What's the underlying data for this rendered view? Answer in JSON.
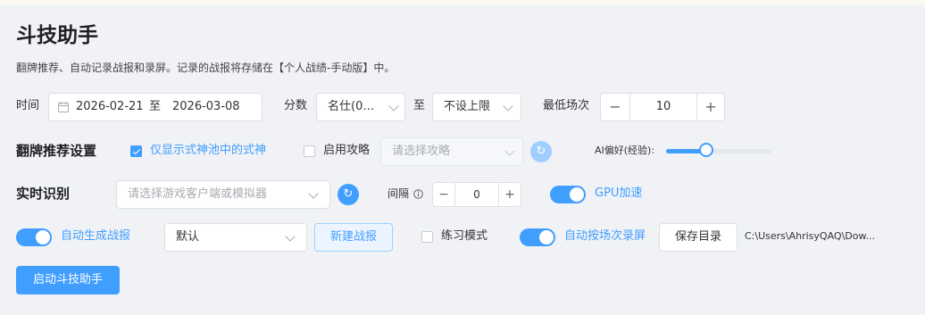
{
  "header": {
    "title": "斗技助手",
    "description": "翻牌推荐、自动记录战报和录屏。记录的战报将存储在【个人战绩-手动版】中。"
  },
  "filters": {
    "time_label": "时间",
    "date_start": "2026-02-21",
    "date_sep": "至",
    "date_end": "2026-03-08",
    "score_label": "分数",
    "score_from": "名仕(0…",
    "score_sep": "至",
    "score_to": "不设上限",
    "min_games_label": "最低场次",
    "min_games_value": "10",
    "minus": "−",
    "plus": "+"
  },
  "flip": {
    "section_title": "翻牌推荐设置",
    "only_pool_label": "仅显示式神池中的式神",
    "only_pool_checked": true,
    "strategy_label": "启用攻略",
    "strategy_checked": false,
    "strategy_placeholder": "请选择攻略",
    "ai_label": "AI偏好(经验):",
    "ai_value": 0.4
  },
  "realtime": {
    "section_title": "实时识别",
    "client_placeholder": "请选择游戏客户端或模拟器",
    "interval_label": "间隔",
    "interval_value": "0",
    "minus": "−",
    "plus": "+",
    "gpu_label": "GPU加速",
    "gpu_on": true
  },
  "report": {
    "auto_report_label": "自动生成战报",
    "auto_report_on": true,
    "template_value": "默认",
    "new_report_button": "新建战报",
    "practice_label": "练习模式",
    "practice_checked": false,
    "auto_record_label": "自动按场次录屏",
    "auto_record_on": true,
    "save_dir_button": "保存目录",
    "save_path": "C:\\Users\\AhrisyQAQ\\Dow..."
  },
  "start_button": "启动斗技助手",
  "colors": {
    "accent": "#409eff",
    "background": "#f0f2f6"
  }
}
